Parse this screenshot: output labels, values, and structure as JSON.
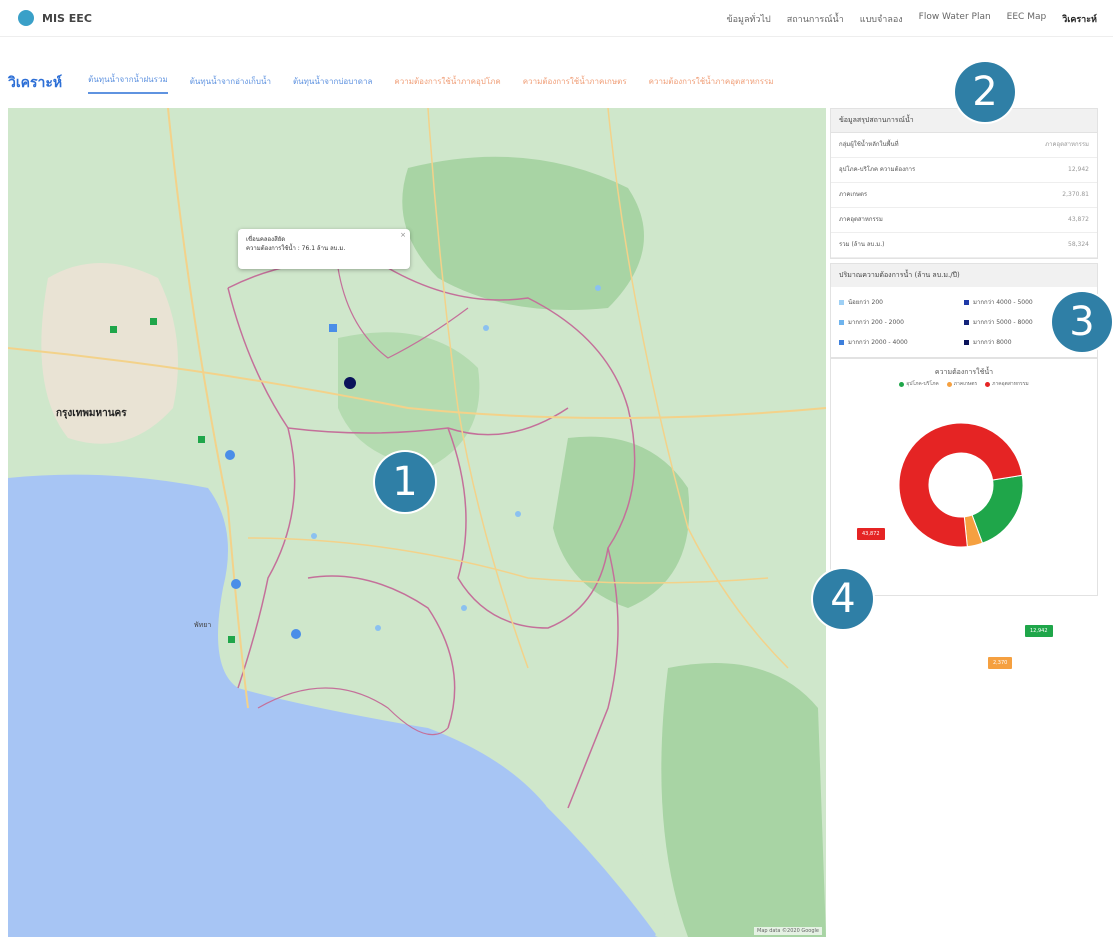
{
  "navbar": {
    "brand": "MIS EEC",
    "links": [
      "ข้อมูลทั่วไป",
      "สถานการณ์น้ำ",
      "แบบจำลอง",
      "Flow Water Plan",
      "EEC Map",
      "วิเคราะห์"
    ]
  },
  "tabs": {
    "heading": "วิเคราะห์",
    "items": [
      {
        "label": "ต้นทุนน้ำจากน้ำฝนรวม",
        "state": "active"
      },
      {
        "label": "ต้นทุนน้ำจากอ่างเก็บน้ำ",
        "state": "normal"
      },
      {
        "label": "ต้นทุนน้ำจากบ่อบาดาล",
        "state": "normal"
      },
      {
        "label": "ความต้องการใช้น้ำภาคอุปโภค",
        "state": "orange"
      },
      {
        "label": "ความต้องการใช้น้ำภาคเกษตร",
        "state": "orange"
      },
      {
        "label": "ความต้องการใช้น้ำภาคอุตสาหกรรม",
        "state": "orange"
      }
    ]
  },
  "map": {
    "popup": {
      "title": "เขื่อนคลองสียัด",
      "text": "ความต้องการใช้น้ำ : 76.1 ล้าน ลบ.ม."
    },
    "city_labels": [
      "กรุงเทพมหานคร",
      "พัทยา"
    ],
    "footer": "Map data ©2020 Google"
  },
  "info_table": {
    "header": "ข้อมูลสรุปสถานการณ์น้ำ",
    "rows": [
      {
        "label": "กลุ่มผู้ใช้น้ำหลักในพื้นที่",
        "value": "ภาคอุตสาหกรรม"
      },
      {
        "label": "อุปโภค-บริโภค ความต้องการ",
        "value": "12,942"
      },
      {
        "label": "ภาคเกษตร",
        "value": "2,370.81"
      },
      {
        "label": "ภาคอุตสาหกรรม",
        "value": "43,872"
      },
      {
        "label": "รวม (ล้าน ลบ.ม.)",
        "value": "58,324"
      }
    ]
  },
  "legend": {
    "title": "ปริมาณความต้องการน้ำ (ล้าน ลบ.ม./ปี)",
    "items": [
      {
        "label": "น้อยกว่า 200",
        "color": "#9ed0f5"
      },
      {
        "label": "มากกว่า 4000 - 5000",
        "color": "#1f3aa8"
      },
      {
        "label": "มากกว่า 200 - 2000",
        "color": "#6fb4ee"
      },
      {
        "label": "มากกว่า 5000 - 8000",
        "color": "#13237a"
      },
      {
        "label": "มากกว่า 2000 - 4000",
        "color": "#3d7fdc"
      },
      {
        "label": "มากกว่า 8000",
        "color": "#0a135a"
      }
    ]
  },
  "donut": {
    "title": "ความต้องการใช้น้ำ",
    "series": [
      {
        "name": "อุปโภค-บริโภค",
        "value": 12.94,
        "color": "#1fa64a",
        "label": "12,942"
      },
      {
        "name": "ภาคเกษตร",
        "value": 2.37,
        "color": "#f5a040",
        "label": "2,370"
      },
      {
        "name": "ภาคอุตสาหกรรม",
        "value": 43.87,
        "color": "#e52424",
        "label": "43,872"
      }
    ]
  },
  "markers": [
    "1",
    "2",
    "3",
    "4"
  ],
  "colors": {
    "accent": "#2f7fa6",
    "tab_blue": "#5f93e0",
    "tab_orange": "#f0a07a"
  }
}
